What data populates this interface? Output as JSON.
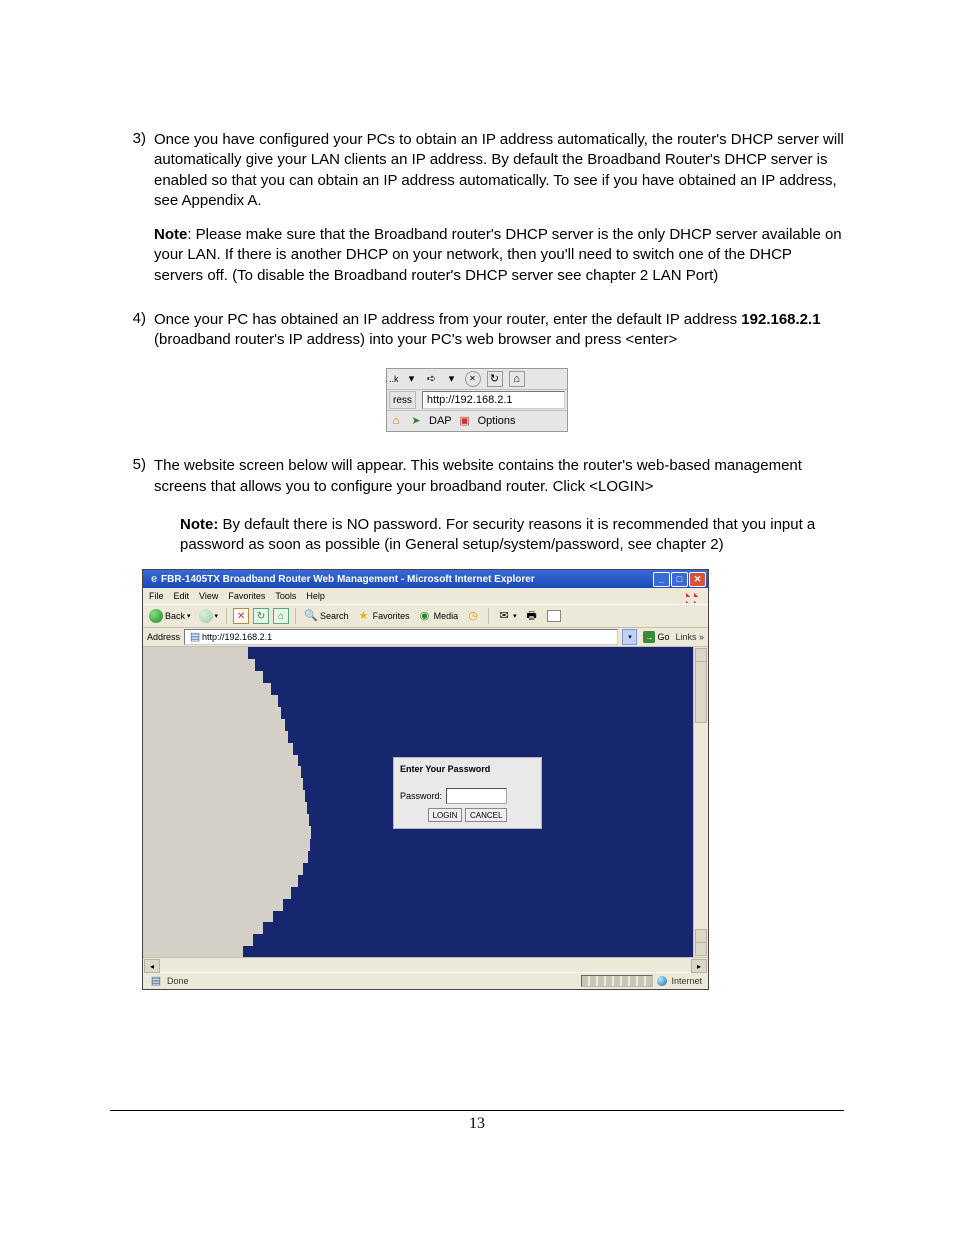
{
  "items": {
    "i3": {
      "num": "3)",
      "body": "Once you have configured your PCs to obtain an IP address automatically, the router's DHCP server will automatically give your LAN clients an IP address. By default the Broadband Router's DHCP server is enabled so that you can obtain an IP address automatically. To see if you have obtained an IP address, see Appendix A.",
      "note_label": "Note",
      "note_rest": ": Please make sure that the Broadband router's DHCP server is the only DHCP server available on your LAN. If there is another DHCP on your network, then you'll need to switch one of the DHCP servers off. (To disable the Broadband router's DHCP server see chapter 2 LAN Port)"
    },
    "i4": {
      "num": "4)",
      "body_a": "Once your PC has obtained an IP address from your router, enter the default IP address ",
      "ip": "192.168.2.1",
      "body_b": " (broadband router's IP address) into your PC's web browser and press <enter>"
    },
    "i5": {
      "num": "5)",
      "body": "The website screen below will appear. This website contains the router's web-based management screens that allows you to configure your broadband router. Click <LOGIN>",
      "note_label": "Note:",
      "note_rest": " By default there is NO password. For security reasons it is recommended that you input a password as soon as possible (in General setup/system/password, see chapter 2)"
    }
  },
  "addrfig": {
    "ress": "ress",
    "url": "http://192.168.2.1",
    "dap": "DAP",
    "options": "Options"
  },
  "browser": {
    "title": "FBR-1405TX Broadband Router Web Management - Microsoft Internet Explorer",
    "menus": [
      "File",
      "Edit",
      "View",
      "Favorites",
      "Tools",
      "Help"
    ],
    "toolbar": {
      "back": "Back",
      "search": "Search",
      "favorites": "Favorites",
      "media": "Media"
    },
    "address_label": "Address",
    "address_url": "http://192.168.2.1",
    "go": "Go",
    "links": "Links",
    "login": {
      "header": "Enter Your Password",
      "pw_label": "Password:",
      "login_btn": "LOGIN",
      "cancel_btn": "CANCEL"
    },
    "status_done": "Done",
    "status_zone": "Internet"
  },
  "page_number": "13"
}
